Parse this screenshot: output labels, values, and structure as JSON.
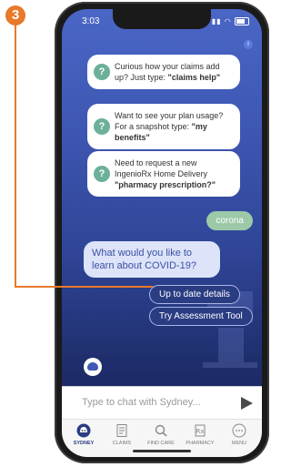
{
  "annotation": {
    "step_number": "3",
    "accent": "#e8782a"
  },
  "status_bar": {
    "time": "3:03"
  },
  "chat": {
    "tips": [
      {
        "text": "Curious how your claims add up? Just type: ",
        "keyword": "\"claims help\""
      },
      {
        "text": "Want to see your plan usage? For a snapshot type: ",
        "keyword": "\"my benefits\""
      },
      {
        "text": "Need to request a new IngenioRx Home Delivery ",
        "keyword": "\"pharmacy prescription?\""
      }
    ],
    "user_message": "corona",
    "bot_message": "What would you like to learn about COVID-19?",
    "quick_replies": [
      "Up to date details",
      "Try Assessment Tool"
    ]
  },
  "input": {
    "placeholder": "Type to chat with Sydney..."
  },
  "tabbar": {
    "items": [
      {
        "label": "SYDNEY",
        "icon": "sydney-bot-icon",
        "active": true
      },
      {
        "label": "CLAIMS",
        "icon": "claims-document-icon",
        "active": false
      },
      {
        "label": "FIND CARE",
        "icon": "search-icon",
        "active": false
      },
      {
        "label": "PHARMACY",
        "icon": "pharmacy-icon",
        "active": false
      },
      {
        "label": "MENU",
        "icon": "menu-dots-icon",
        "active": false
      }
    ]
  },
  "colors": {
    "brand": "#3f58b4",
    "user_bubble": "#9cc9a8",
    "tip_icon": "#6cb09a"
  }
}
